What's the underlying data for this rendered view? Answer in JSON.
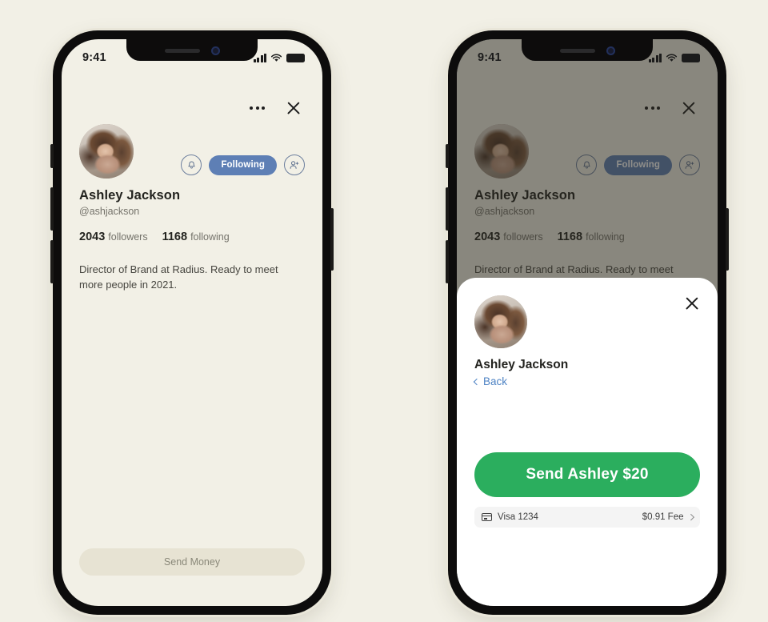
{
  "meta": {
    "background_color": "#F2F0E6",
    "accent_blue": "#5E7FB5",
    "accent_green": "#2BAE5E",
    "link_blue": "#4E83C4"
  },
  "status_bar": {
    "time": "9:41",
    "signal_icon": "cellular-signal-icon",
    "wifi_icon": "wifi-icon",
    "battery_icon": "battery-icon"
  },
  "profile": {
    "more_icon": "more-options-icon",
    "close_icon": "close-icon",
    "avatar_alt": "Ashley Jackson profile photo",
    "notify_icon": "bell-icon",
    "follow_button_label": "Following",
    "add_icon": "add-person-sparkle-icon",
    "name": "Ashley Jackson",
    "handle": "@ashjackson",
    "followers_count": "2043",
    "followers_label": "followers",
    "following_count": "1168",
    "following_label": "following",
    "bio": "Director of Brand at Radius. Ready to meet more people in 2021.",
    "send_money_label": "Send Money"
  },
  "sheet": {
    "close_icon": "close-icon",
    "avatar_alt": "Ashley Jackson profile photo",
    "name": "Ashley Jackson",
    "back_label": "Back",
    "back_icon": "chevron-left-icon",
    "send_button_label": "Send Ashley $20",
    "payment_method_icon": "credit-card-icon",
    "payment_method": "Visa 1234",
    "fee": "$0.91 Fee",
    "fee_chevron_icon": "chevron-right-icon"
  }
}
